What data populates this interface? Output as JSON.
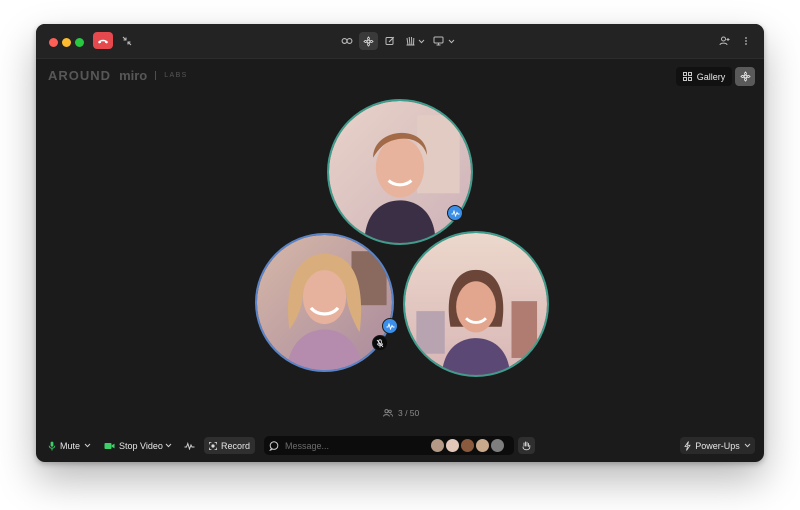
{
  "app": {
    "logo_text": "AROUND",
    "brand": "miro",
    "brand_suffix": "LABS"
  },
  "titlebar": {
    "icons": [
      "hangup-icon",
      "collapse-icon",
      "link-icon",
      "settings-flower-icon",
      "edit-icon",
      "clap-icon",
      "chevron-down-icon",
      "screen-share-icon",
      "chevron-down-icon",
      "add-person-icon",
      "more-vertical-icon"
    ]
  },
  "view": {
    "gallery_label": "Gallery"
  },
  "participants": {
    "count_text": "3 / 50",
    "tiles": [
      {
        "name": "participant-1",
        "speaking": true
      },
      {
        "name": "participant-2",
        "speaking": true,
        "muted": true
      },
      {
        "name": "participant-3",
        "speaking": false
      }
    ]
  },
  "toolbar": {
    "mute_label": "Mute",
    "stop_video_label": "Stop Video",
    "record_label": "Record",
    "message_placeholder": "Message...",
    "powerups_label": "Power-Ups"
  },
  "colors": {
    "window_bg": "#1b1b1b",
    "titlebar_bg": "#232323",
    "hangup": "#e5484d",
    "speaking_ring": "#3e9d8c",
    "active_ring": "#5b84c7",
    "badge_blue": "#3b8fe8",
    "mic_green": "#3fcf6a"
  }
}
